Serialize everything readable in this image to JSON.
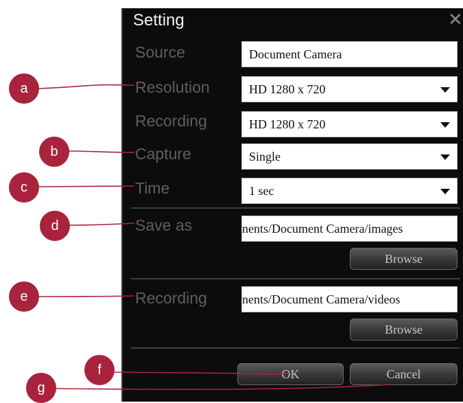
{
  "dialog": {
    "title": "Setting",
    "close_glyph": "✕"
  },
  "rows": {
    "source": {
      "label": "Source",
      "value": "Document Camera"
    },
    "resolution": {
      "label": "Resolution",
      "value": "HD 1280 x 720"
    },
    "recording": {
      "label": "Recording",
      "value": "HD 1280 x 720"
    },
    "capture": {
      "label": "Capture",
      "value": "Single"
    },
    "time": {
      "label": "Time",
      "value": "1 sec"
    },
    "save_as": {
      "label": "Save as",
      "value": "nents/Document Camera/images"
    },
    "recording_path": {
      "label": "Recording",
      "value": "nents/Document Camera/videos"
    }
  },
  "buttons": {
    "browse_images": "Browse",
    "browse_videos": "Browse",
    "ok": "OK",
    "cancel": "Cancel"
  },
  "callouts": [
    "a",
    "b",
    "c",
    "d",
    "e",
    "f",
    "g"
  ],
  "colors": {
    "callout": "#a8233b",
    "dialog_bg": "#0c0c0c",
    "label": "#5f5f5f"
  }
}
